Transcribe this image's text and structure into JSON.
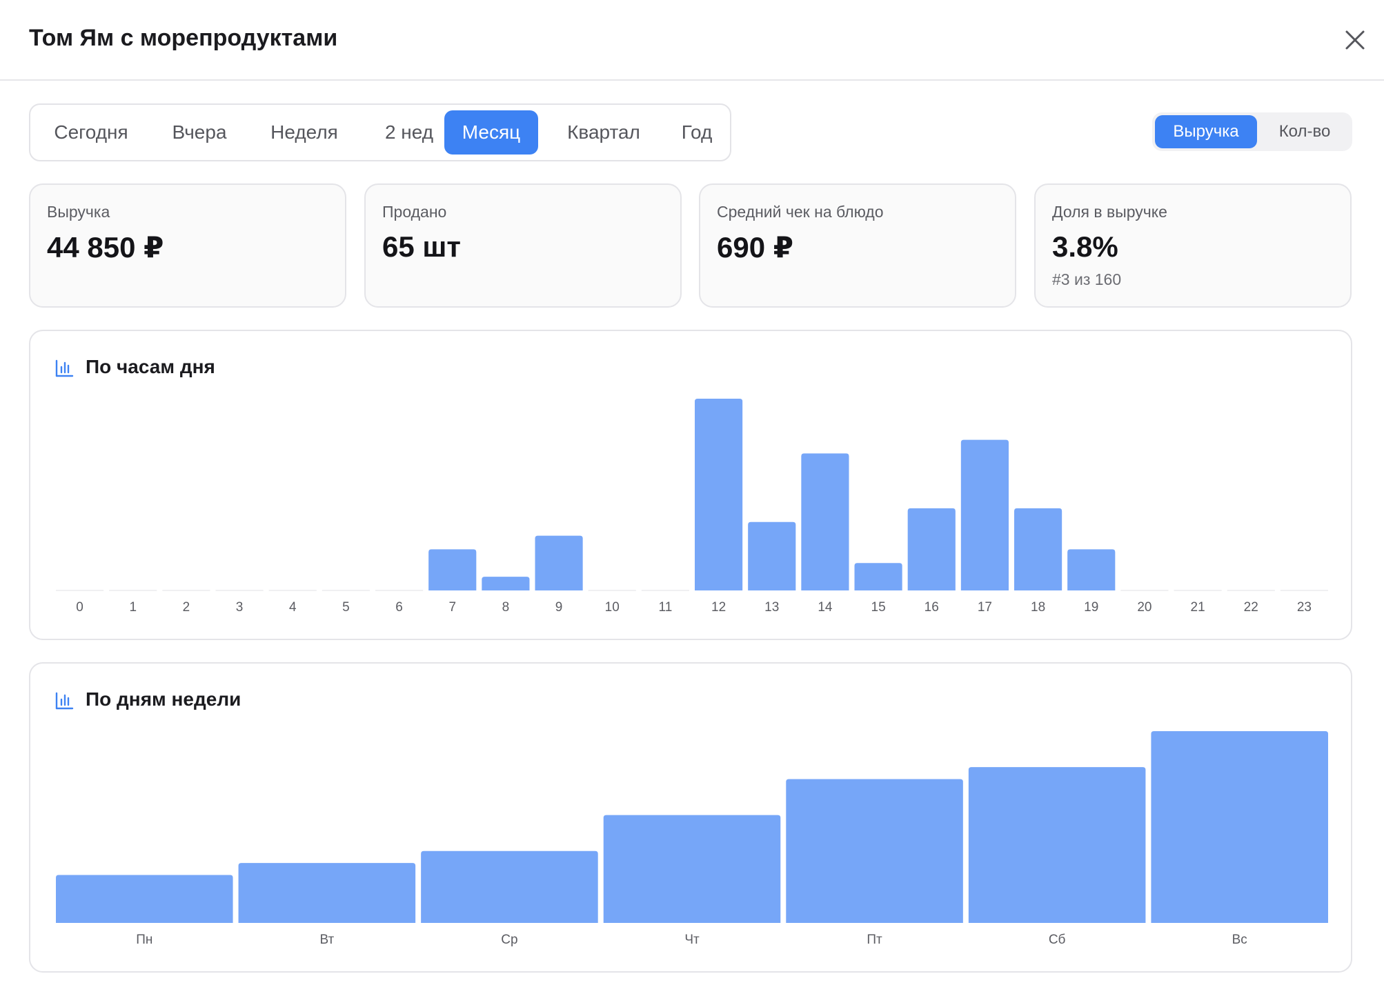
{
  "header": {
    "title": "Том Ям с морепродуктами",
    "close_icon": "close-icon"
  },
  "periods": {
    "items": [
      "Сегодня",
      "Вчера",
      "Неделя",
      "2 нед",
      "Месяц",
      "Квартал",
      "Год"
    ],
    "active": "Месяц"
  },
  "mode": {
    "revenue_label": "Выручка",
    "qty_label": "Кол-во",
    "active": "Выручка"
  },
  "cards": {
    "revenue": {
      "label": "Выручка",
      "value": "44 850 ₽"
    },
    "sold": {
      "label": "Продано",
      "value": "65 шт"
    },
    "avg_check": {
      "label": "Средний чек на блюдо",
      "value": "690 ₽"
    },
    "share": {
      "label": "Доля в выручке",
      "value": "3.8%",
      "sub": "#3 из 160"
    }
  },
  "colors": {
    "accent": "#3d82f3",
    "bar": "#76a6f8",
    "border": "#e4e4e8"
  },
  "chart_data": [
    {
      "type": "bar",
      "title": "По часам дня",
      "categories": [
        "0",
        "1",
        "2",
        "3",
        "4",
        "5",
        "6",
        "7",
        "8",
        "9",
        "10",
        "11",
        "12",
        "13",
        "14",
        "15",
        "16",
        "17",
        "18",
        "19",
        "20",
        "21",
        "22",
        "23"
      ],
      "values": [
        0,
        0,
        0,
        0,
        0,
        0,
        0,
        3,
        1,
        4,
        0,
        0,
        14,
        5,
        10,
        2,
        6,
        11,
        6,
        3,
        0,
        0,
        0,
        0
      ],
      "ylim": [
        0,
        14
      ],
      "grid": false
    },
    {
      "type": "bar",
      "title": "По дням недели",
      "categories": [
        "Пн",
        "Вт",
        "Ср",
        "Чт",
        "Пт",
        "Сб",
        "Вс"
      ],
      "values": [
        4,
        5,
        6,
        9,
        12,
        13,
        16
      ],
      "ylim": [
        0,
        16
      ],
      "grid": false
    }
  ]
}
